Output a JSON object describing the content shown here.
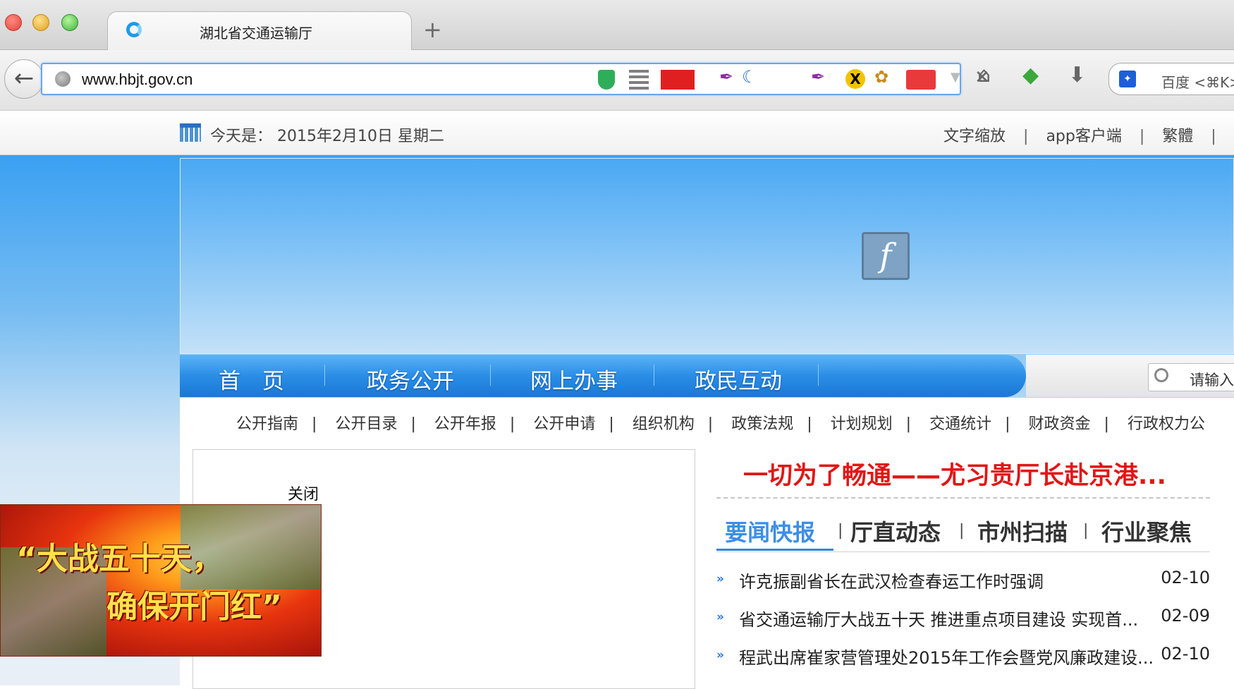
{
  "browser": {
    "tab_title": "湖北省交通运输厅",
    "new_tab": "+",
    "url": "www.hbjt.gov.cn",
    "search_engine_placeholder": "百度 <⌘K>",
    "icons": [
      "back-icon",
      "globe-icon",
      "shield-icon",
      "qr-code-icon",
      "china-flag-icon",
      "feather-icon",
      "moon-icon",
      "x-icon",
      "squirrel-icon",
      "red-flag-icon",
      "dropdown-icon",
      "close-icon",
      "home-icon",
      "frog-icon",
      "download-icon",
      "baidu-paw-icon"
    ]
  },
  "infobar": {
    "date_prefix": "今天是：",
    "date": "2015年2月10日 星期二",
    "links": [
      "文字缩放",
      "app客户端",
      "繁體"
    ],
    "separator": "|"
  },
  "main_nav": {
    "items": [
      "首　页",
      "政务公开",
      "网上办事",
      "政民互动"
    ],
    "search_placeholder": "请输入"
  },
  "sub_nav": {
    "items": [
      "公开指南",
      "公开目录",
      "公开年报",
      "公开申请",
      "组织机构",
      "政策法规",
      "计划规划",
      "交通统计",
      "财政资金",
      "行政权力公"
    ],
    "separator": "|"
  },
  "left_panel": {
    "close_label": "关闭"
  },
  "ad": {
    "line1": "“大战五十天，",
    "line2": "确保开门红”"
  },
  "headline": "一切为了畅通——尤习贵厅长赴京港...",
  "news_tabs": {
    "items": [
      "要闻快报",
      "厅直动态",
      "市州扫描",
      "行业聚焦"
    ],
    "active_index": 0,
    "separator": "|"
  },
  "news": [
    {
      "title": "许克振副省长在武汉检查春运工作时强调",
      "date": "02-10"
    },
    {
      "title": "省交通运输厅大战五十天 推进重点项目建设 实现首...",
      "date": "02-09"
    },
    {
      "title": "程武出席崔家营管理处2015年工作会暨党风廉政建设...",
      "date": "02-10"
    }
  ],
  "colors": {
    "nav_blue": "#2a8de6",
    "headline_red": "#e11616",
    "active_tab_blue": "#3c8ee6"
  }
}
